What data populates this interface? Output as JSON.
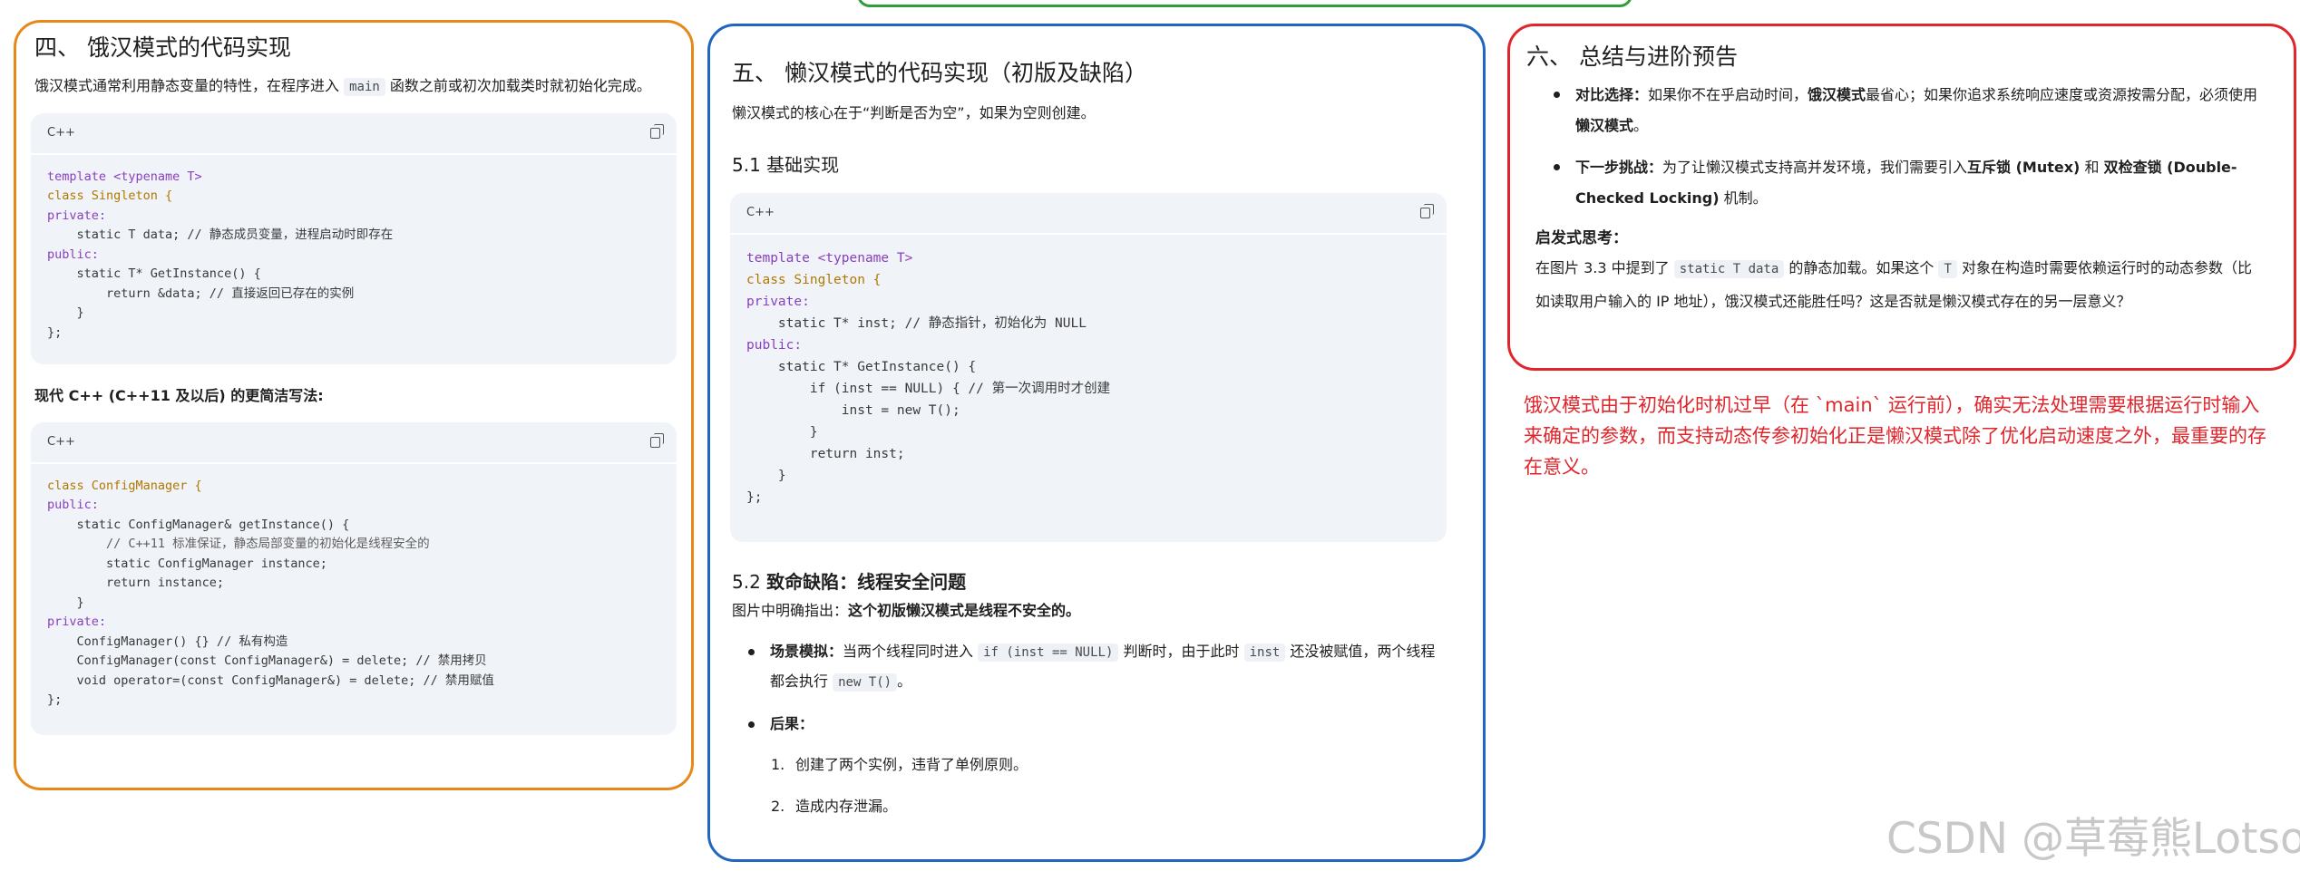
{
  "sec4": {
    "title": "四、 饿汉模式的代码实现",
    "intro_a": "饿汉模式通常利用静态变量的特性，在程序进入 ",
    "intro_code": "main",
    "intro_b": " 函数之前或初次加载类时就初始化完成。",
    "code1_lang": "C++",
    "code1": [
      "template <typename T>",
      "class Singleton {",
      "private:",
      "    static T data; // 静态成员变量，进程启动时即存在",
      "public:",
      "    static T* GetInstance() {",
      "        return &data; // 直接返回已存在的实例",
      "    }",
      "};"
    ],
    "subtitle": "现代 C++ (C++11 及以后) 的更简洁写法:",
    "code2_lang": "C++",
    "code2": [
      "class ConfigManager {",
      "public:",
      "    static ConfigManager& getInstance() {",
      "        // C++11 标准保证，静态局部变量的初始化是线程安全的",
      "        static ConfigManager instance;",
      "        return instance;",
      "    }",
      "private:",
      "    ConfigManager() {} // 私有构造",
      "    ConfigManager(const ConfigManager&) = delete; // 禁用拷贝",
      "    void operator=(const ConfigManager&) = delete; // 禁用赋值",
      "};"
    ]
  },
  "sec5": {
    "title": "五、 懒汉模式的代码实现（初版及缺陷）",
    "intro": "懒汉模式的核心在于“判断是否为空”，如果为空则创建。",
    "sub1": "5.1 基础实现",
    "code_lang": "C++",
    "code": [
      "template <typename T>",
      "class Singleton {",
      "private:",
      "    static T* inst; // 静态指针，初始化为 NULL",
      "public:",
      "    static T* GetInstance() {",
      "        if (inst == NULL) { // 第一次调用时才创建",
      "            inst = new T();",
      "        }",
      "        return inst;",
      "    }",
      "};"
    ],
    "sub2_a": "5.2 ",
    "sub2_b": "致命缺陷：线程安全问题",
    "point_a": "图片中明确指出：",
    "point_b": "这个初版懒汉模式是线程不安全的。",
    "b1_label": "场景模拟：",
    "b1_a": "当两个线程同时进入 ",
    "b1_code1": "if (inst == NULL)",
    "b1_b": " 判断时，由于此时 ",
    "b1_code2": "inst",
    "b1_c": " 还没被赋值，两个线程都会执行 ",
    "b1_code3": "new T()",
    "b1_d": "。",
    "b2_label": "后果：",
    "n1": "1.",
    "c1": "创建了两个实例，违背了单例原则。",
    "n2": "2.",
    "c2": "造成内存泄漏。"
  },
  "sec6": {
    "title": "六、 总结与进阶预告",
    "b1_label": "对比选择：",
    "b1_a": "如果你不在乎启动时间，",
    "b1_bold": "饿汉模式",
    "b1_b": "最省心；如果你追求系统响应速度或资源按需分配，必须使用",
    "b1_bold2": "懒汉模式",
    "b1_c": "。",
    "b2_label": "下一步挑战：",
    "b2_a": "为了让懒汉模式支持高并发环境，我们需要引入",
    "b2_bold1": "互斥锁 (Mutex)",
    "b2_b": " 和 ",
    "b2_bold2": "双检查锁 (Double-Checked Locking)",
    "b2_c": " 机制。",
    "think_title": "启发式思考：",
    "think_a": "在图片 3.3 中提到了 ",
    "think_code1": "static T data",
    "think_b": " 的静态加载。如果这个 ",
    "think_code2": "T",
    "think_c": " 对象在构造时需要依赖运行时的动态参数（比如读取用户输入的 IP 地址），饿汉模式还能胜任吗？这是否就是懒汉模式存在的另一层意义？"
  },
  "annotation": "饿汉模式由于初始化时机过早（在 `main` 运行前），确实无法处理需要根据运行时输入来确定的参数，而支持动态传参初始化正是懒汉模式除了优化启动速度之外，最重要的存在意义。",
  "watermark": "CSDN @草莓熊Lotso",
  "colors": {
    "orange_border": "#e6891a",
    "blue_border": "#1f66c0",
    "red_border": "#e0252b",
    "green_border": "#2e9d3a",
    "code_bg": "#f0f3f8"
  }
}
